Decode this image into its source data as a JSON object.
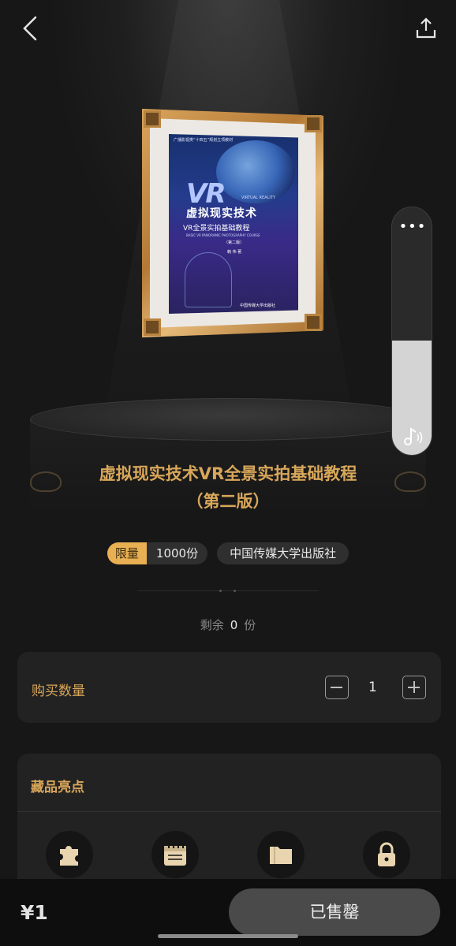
{
  "nav": {
    "back_icon": "chevron-left-icon",
    "share_icon": "share-upload-icon"
  },
  "artwork": {
    "cover_series": "广播影视类“十四五”规划立项教材",
    "cover_vr": "VR",
    "cover_vr_sub": "VIRTUAL REALITY",
    "cover_title": "虚拟现实技术",
    "cover_subtitle": "VR全景实拍基础教程",
    "cover_english": "BASIC VR PANORAMIC PHOTOGRAPHY COURSE",
    "cover_edition": "（第二版）",
    "cover_author": "韩 伟 著",
    "cover_publisher": "中国传媒大学出版社"
  },
  "product": {
    "title_line1": "虚拟现实技术VR全景实拍基础教程",
    "title_line2": "（第二版）"
  },
  "tags": {
    "limit_key": "限量",
    "limit_value": "1000份",
    "publisher": "中国传媒大学出版社"
  },
  "stock": {
    "prefix": "剩余",
    "count": "0",
    "unit": "份"
  },
  "quantity": {
    "label": "购买数量",
    "value": "1"
  },
  "highlights": {
    "title": "藏品亮点",
    "icons": [
      "puzzle-icon",
      "calendar-icon",
      "folder-icon",
      "lock-icon"
    ]
  },
  "side_panel": {
    "more_label": "•••",
    "music_icon": "music-note-icon",
    "volume_level": 0.46
  },
  "bottom": {
    "price": "¥1",
    "button_label": "已售罄"
  },
  "colors": {
    "accent": "#d9a75a",
    "tag": "#e8b052",
    "background": "#171717"
  }
}
